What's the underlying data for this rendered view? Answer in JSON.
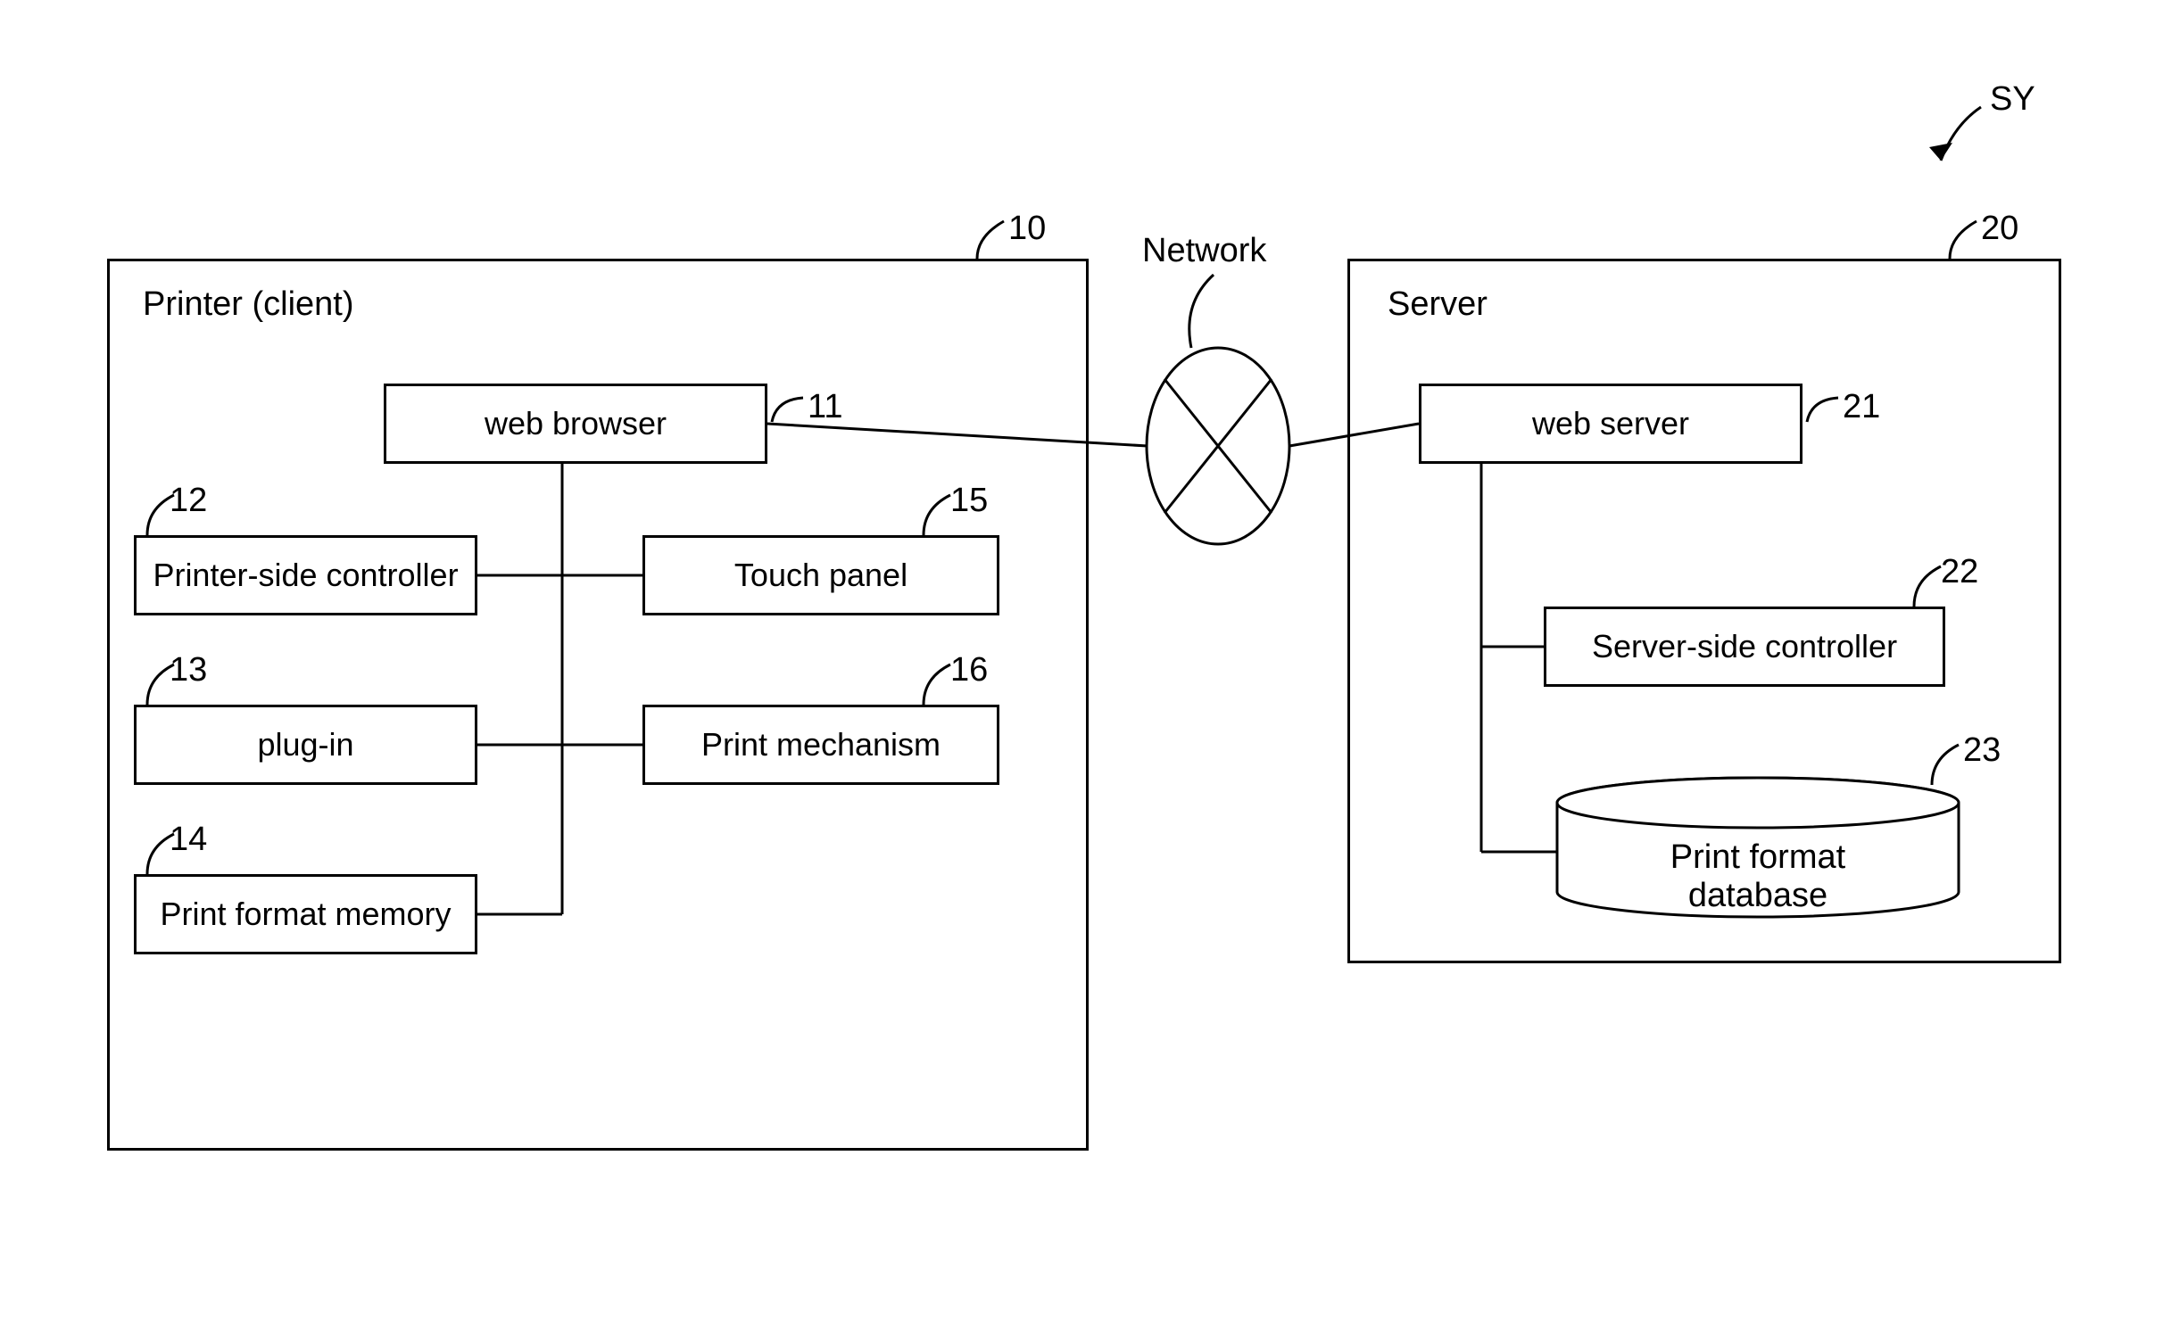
{
  "sy_label": "SY",
  "network_label": "Network",
  "printer": {
    "title": "Printer (client)",
    "ref": "10",
    "blocks": {
      "web_browser": {
        "label": "web browser",
        "ref": "11"
      },
      "printer_side_controller": {
        "label": "Printer-side controller",
        "ref": "12"
      },
      "plug_in": {
        "label": "plug-in",
        "ref": "13"
      },
      "print_format_memory": {
        "label": "Print format memory",
        "ref": "14"
      },
      "touch_panel": {
        "label": "Touch panel",
        "ref": "15"
      },
      "print_mechanism": {
        "label": "Print mechanism",
        "ref": "16"
      }
    }
  },
  "server": {
    "title": "Server",
    "ref": "20",
    "blocks": {
      "web_server": {
        "label": "web server",
        "ref": "21"
      },
      "server_side_controller": {
        "label": "Server-side controller",
        "ref": "22"
      },
      "print_format_database": {
        "label": "Print format database",
        "ref": "23"
      }
    }
  }
}
